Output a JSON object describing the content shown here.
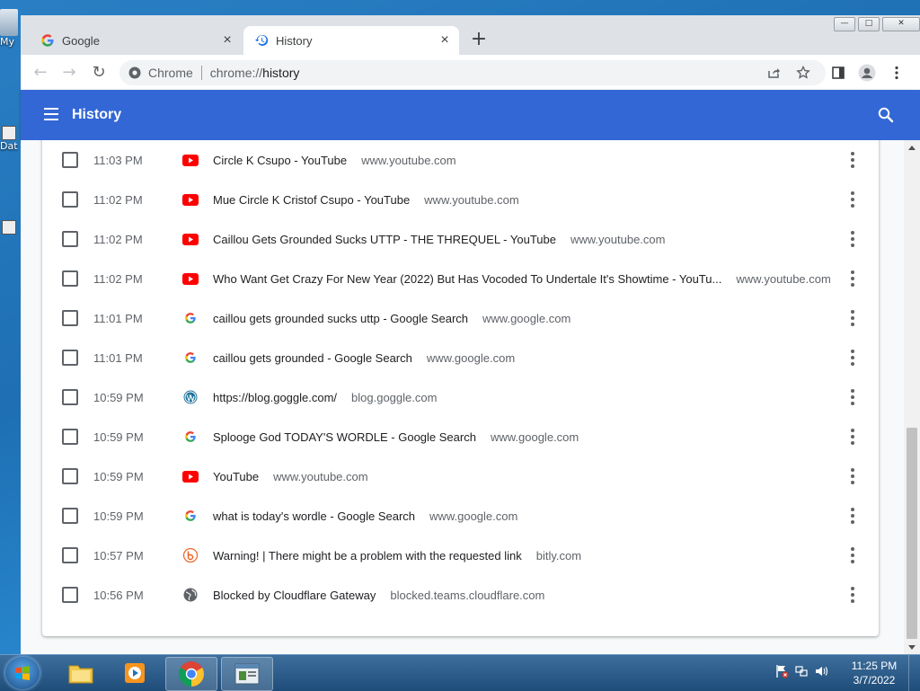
{
  "desktop": {
    "icons": [
      {
        "label": "My"
      },
      {
        "label": "Dat"
      }
    ]
  },
  "tabs": [
    {
      "title": "Google",
      "icon": "google-icon",
      "active": false
    },
    {
      "title": "History",
      "icon": "history-icon",
      "active": true
    }
  ],
  "toolbar": {
    "site_chip": "Chrome",
    "url_scheme": "chrome://",
    "url_path": "history"
  },
  "header": {
    "title": "History"
  },
  "history": [
    {
      "time": "11:03 PM",
      "title": "Circle K Csupo - YouTube",
      "domain": "www.youtube.com",
      "icon": "youtube"
    },
    {
      "time": "11:02 PM",
      "title": "Mue Circle K Cristof Csupo - YouTube",
      "domain": "www.youtube.com",
      "icon": "youtube"
    },
    {
      "time": "11:02 PM",
      "title": "Caillou Gets Grounded Sucks UTTP - THE THREQUEL - YouTube",
      "domain": "www.youtube.com",
      "icon": "youtube"
    },
    {
      "time": "11:02 PM",
      "title": "Who Want Get Crazy For New Year (2022) But Has Vocoded To Undertale It's Showtime - YouTu...",
      "domain": "www.youtube.com",
      "icon": "youtube"
    },
    {
      "time": "11:01 PM",
      "title": "caillou gets grounded sucks uttp - Google Search",
      "domain": "www.google.com",
      "icon": "google"
    },
    {
      "time": "11:01 PM",
      "title": "caillou gets grounded - Google Search",
      "domain": "www.google.com",
      "icon": "google"
    },
    {
      "time": "10:59 PM",
      "title": "https://blog.goggle.com/",
      "domain": "blog.goggle.com",
      "icon": "wordpress"
    },
    {
      "time": "10:59 PM",
      "title": "Splooge God TODAY'S WORDLE - Google Search",
      "domain": "www.google.com",
      "icon": "google"
    },
    {
      "time": "10:59 PM",
      "title": "YouTube",
      "domain": "www.youtube.com",
      "icon": "youtube"
    },
    {
      "time": "10:59 PM",
      "title": "what is today's wordle - Google Search",
      "domain": "www.google.com",
      "icon": "google"
    },
    {
      "time": "10:57 PM",
      "title": "Warning! | There might be a problem with the requested link",
      "domain": "bitly.com",
      "icon": "bitly"
    },
    {
      "time": "10:56 PM",
      "title": "Blocked by Cloudflare Gateway",
      "domain": "blocked.teams.cloudflare.com",
      "icon": "globe"
    }
  ],
  "taskbar": {
    "items": [
      {
        "name": "explorer",
        "icon": "folder-icon"
      },
      {
        "name": "media-player",
        "icon": "media-player-icon"
      },
      {
        "name": "chrome",
        "icon": "chrome-icon"
      },
      {
        "name": "app-window",
        "icon": "window-icon"
      }
    ],
    "clock_time": "11:25 PM",
    "clock_date": "3/7/2022"
  },
  "colors": {
    "header_blue": "#3367d6",
    "youtube_red": "#ff0000",
    "taskbar": "#1f4d7a"
  }
}
